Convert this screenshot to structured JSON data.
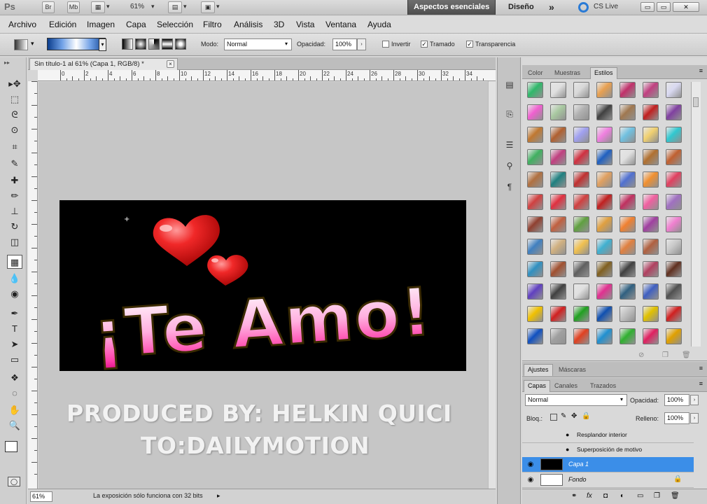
{
  "appbar": {
    "logo": "Ps",
    "btn_br": "Br",
    "btn_mb": "Mb",
    "zoom": "61%",
    "workspace_active": "Aspectos esenciales",
    "workspace_design": "Diseño",
    "more": "»",
    "cs_live": "CS Live",
    "win_min": "▭",
    "win_restore": "▭",
    "win_close": "✕"
  },
  "menu": [
    "Archivo",
    "Edición",
    "Imagen",
    "Capa",
    "Selección",
    "Filtro",
    "Análisis",
    "3D",
    "Vista",
    "Ventana",
    "Ayuda"
  ],
  "options": {
    "mode_label": "Modo:",
    "mode_value": "Normal",
    "opacity_label": "Opacidad:",
    "opacity_value": "100%",
    "invert_label": "Invertir",
    "dither_label": "Tramado",
    "transparency_label": "Transparencia",
    "check_mark": "✓"
  },
  "document": {
    "tab_title": "Sin título-1 al 61% (Capa 1, RGB/8) *",
    "tab_close": "×",
    "ruler_numbers": [
      "0",
      "2",
      "4",
      "6",
      "8",
      "10",
      "12",
      "14",
      "16",
      "18",
      "20",
      "22",
      "24",
      "26",
      "28",
      "30",
      "32",
      "34"
    ],
    "artwork_text": "¡Te Amo!",
    "watermark_line1": "PRODUCED BY: HELKIN QUICI",
    "watermark_line2": "TO:DAILYMOTION",
    "status_zoom": "61%",
    "status_text": "La exposición sólo funciona con 32 bits"
  },
  "tools": [
    "move",
    "marquee",
    "lasso",
    "quick-select",
    "crop",
    "eyedropper",
    "healing",
    "brush",
    "clone-stamp",
    "history-brush",
    "eraser",
    "gradient",
    "blur",
    "dodge",
    "pen",
    "type",
    "path-select",
    "shape",
    "3d-rotate",
    "3d-orbit",
    "hand",
    "zoom"
  ],
  "tool_glyphs": [
    "▸✥",
    "⬚",
    "ᘓ",
    "⊙",
    "⌗",
    "✎",
    "✚",
    "✏",
    "⊥",
    "↻",
    "◫",
    "▦",
    "💧",
    "◉",
    "✒",
    "T",
    "➤",
    "▭",
    "❖",
    "◌",
    "✋",
    "🔍"
  ],
  "styles_panel": {
    "tabs": [
      "Color",
      "Muestras",
      "Estilos"
    ],
    "active_tab": "Estilos",
    "swatch_colors": [
      "#2fb86a",
      "#e0e0e0",
      "#d8d8d8",
      "#e8a050",
      "#c0306a",
      "#c04080",
      "#d8d8f0",
      "#f060d0",
      "#a8c8a0",
      "#b0b0b0",
      "#404040",
      "#a07850",
      "#c02020",
      "#8040a0",
      "#c07830",
      "#b06030",
      "#a0a0f0",
      "#f080e0",
      "#70c0e0",
      "#f0d070",
      "#30c8d0",
      "#40b060",
      "#c04080",
      "#d03040",
      "#2060c0",
      "#e0e0e0",
      "#b07030",
      "#c06030",
      "#b07040",
      "#208080",
      "#c03030",
      "#e0a060",
      "#5070d0",
      "#f09030",
      "#e04060",
      "#d04040",
      "#e03040",
      "#d04040",
      "#c02020",
      "#c03060",
      "#f060a0",
      "#a070c0",
      "#904030",
      "#c06040",
      "#60a040",
      "#e0a040",
      "#f08030",
      "#a040a0",
      "#f080d0",
      "#4080c0",
      "#d0b080",
      "#f0c050",
      "#40b0d0",
      "#e08040",
      "#b06040",
      "#c8c8c8",
      "#3090c0",
      "#a05030",
      "#606060",
      "#806020",
      "#404040",
      "#b04060",
      "#603020",
      "#6040c0",
      "#404040",
      "#e0e0e0",
      "#e03090",
      "#306080",
      "#4060c0",
      "#505050",
      "#f0c000",
      "#d02020",
      "#20a020",
      "#1050b0",
      "#c0c0c0",
      "#e0c000",
      "#d02020",
      "#1050c0",
      "#a0a0a0",
      "#e04020",
      "#2090d0",
      "#30b030",
      "#e02060",
      "#e0a000"
    ]
  },
  "adjust_panel": {
    "tabs": [
      "Ajustes",
      "Máscaras"
    ]
  },
  "layers_panel": {
    "tabs": [
      "Capas",
      "Canales",
      "Trazados"
    ],
    "blend_mode": "Normal",
    "opacity_label": "Opacidad:",
    "opacity_value": "100%",
    "lock_label": "Bloq.:",
    "fill_label": "Relleno:",
    "fill_value": "100%",
    "effect1": "Resplandor interior",
    "effect2": "Superposición de motivo",
    "layer1": "Capa 1",
    "layer2": "Fondo",
    "eye": "👁"
  },
  "colors": {
    "accent": "#3b8ee8",
    "heart": "#d81c1c",
    "text_pink": "#ff4fb0"
  }
}
